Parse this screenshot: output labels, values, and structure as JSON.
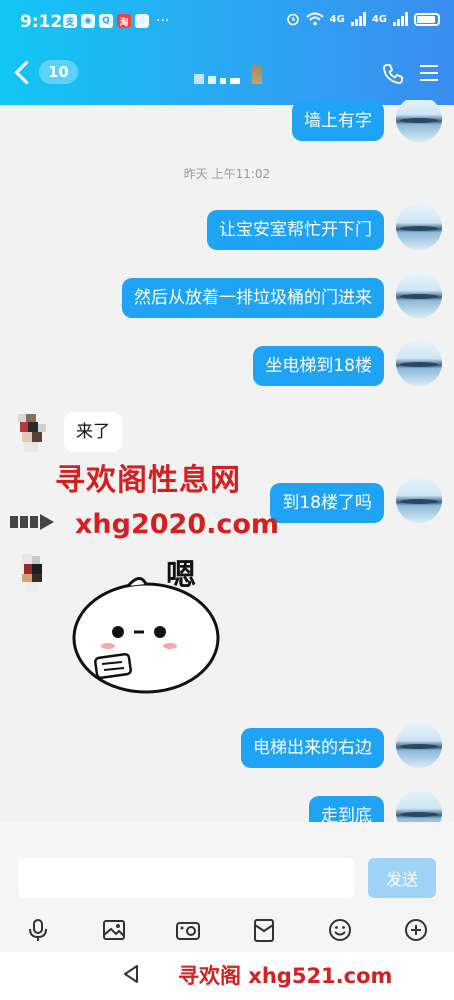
{
  "status_bar": {
    "time": "9:12",
    "app_icons": [
      "支",
      "◉",
      "Q",
      "淘",
      "♢"
    ],
    "more": "···",
    "network_1": "4G",
    "network_2": "4G"
  },
  "nav": {
    "unread_count": "10",
    "icons": [
      "back-icon",
      "phone-icon",
      "menu-icon"
    ]
  },
  "timestamp": "昨天 上午11:02",
  "messages": [
    {
      "dir": "out",
      "text": "墙上有字"
    },
    {
      "dir": "out",
      "text": "让宝安室帮忙开下门"
    },
    {
      "dir": "out",
      "text": "然后从放着一排垃圾桶的门进来"
    },
    {
      "dir": "out",
      "text": "坐电梯到18楼"
    },
    {
      "dir": "in",
      "text": "来了"
    },
    {
      "dir": "out",
      "text": "到18楼了吗"
    },
    {
      "dir": "in",
      "sticker": "嗯"
    },
    {
      "dir": "out",
      "text": "电梯出来的右边"
    },
    {
      "dir": "out",
      "text": "走到底"
    }
  ],
  "sticker_text": "嗯",
  "watermarks": {
    "line1": "寻欢阁性息网",
    "line2": "xhg2020.com",
    "line3": "寻欢阁 xhg521.com"
  },
  "input": {
    "placeholder": "",
    "send_label": "发送"
  },
  "colors": {
    "accent": "#1fa3f5",
    "header_start": "#12c6f4",
    "header_end": "#3a8df0",
    "watermark": "#d42020"
  }
}
